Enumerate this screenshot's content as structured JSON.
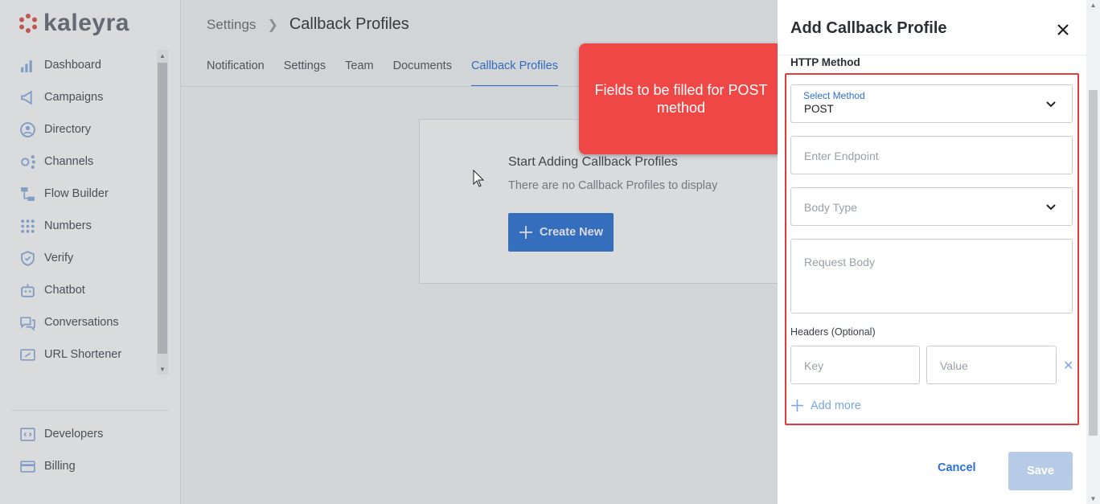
{
  "brand": {
    "name": "kaleyra"
  },
  "sidebar": {
    "items": [
      {
        "label": "Dashboard",
        "icon": "bar-chart-icon"
      },
      {
        "label": "Campaigns",
        "icon": "megaphone-icon"
      },
      {
        "label": "Directory",
        "icon": "contact-icon"
      },
      {
        "label": "Channels",
        "icon": "channels-icon"
      },
      {
        "label": "Flow Builder",
        "icon": "flow-icon"
      },
      {
        "label": "Numbers",
        "icon": "dialpad-icon"
      },
      {
        "label": "Verify",
        "icon": "shield-icon"
      },
      {
        "label": "Chatbot",
        "icon": "bot-icon"
      },
      {
        "label": "Conversations",
        "icon": "chat-bubbles-icon"
      },
      {
        "label": "URL Shortener",
        "icon": "link-icon"
      }
    ],
    "bottom_items": [
      {
        "label": "Developers",
        "icon": "code-icon"
      },
      {
        "label": "Billing",
        "icon": "card-icon"
      }
    ]
  },
  "header": {
    "breadcrumb_parent": "Settings",
    "breadcrumb_current": "Callback Profiles"
  },
  "tabs": [
    {
      "label": "Notification",
      "active": false
    },
    {
      "label": "Settings",
      "active": false
    },
    {
      "label": "Team",
      "active": false
    },
    {
      "label": "Documents",
      "active": false
    },
    {
      "label": "Callback Profiles",
      "active": true
    }
  ],
  "empty_state": {
    "title": "Start Adding Callback Profiles",
    "subtitle": "There are no Callback Profiles to display",
    "button": "Create New"
  },
  "callout": {
    "text": "Fields to be filled for POST method"
  },
  "panel": {
    "title": "Add Callback Profile",
    "http_method_label": "HTTP Method",
    "method": {
      "label": "Select Method",
      "value": "POST"
    },
    "endpoint_placeholder": "Enter Endpoint",
    "body_type_placeholder": "Body Type",
    "request_body_placeholder": "Request Body",
    "headers_label": "Headers (Optional)",
    "key_placeholder": "Key",
    "value_placeholder": "Value",
    "add_more": "Add more",
    "cancel": "Cancel",
    "save": "Save"
  },
  "colors": {
    "accent": "#2f74d8",
    "callout": "#ef4646",
    "highlight_border": "#e23b3b"
  }
}
